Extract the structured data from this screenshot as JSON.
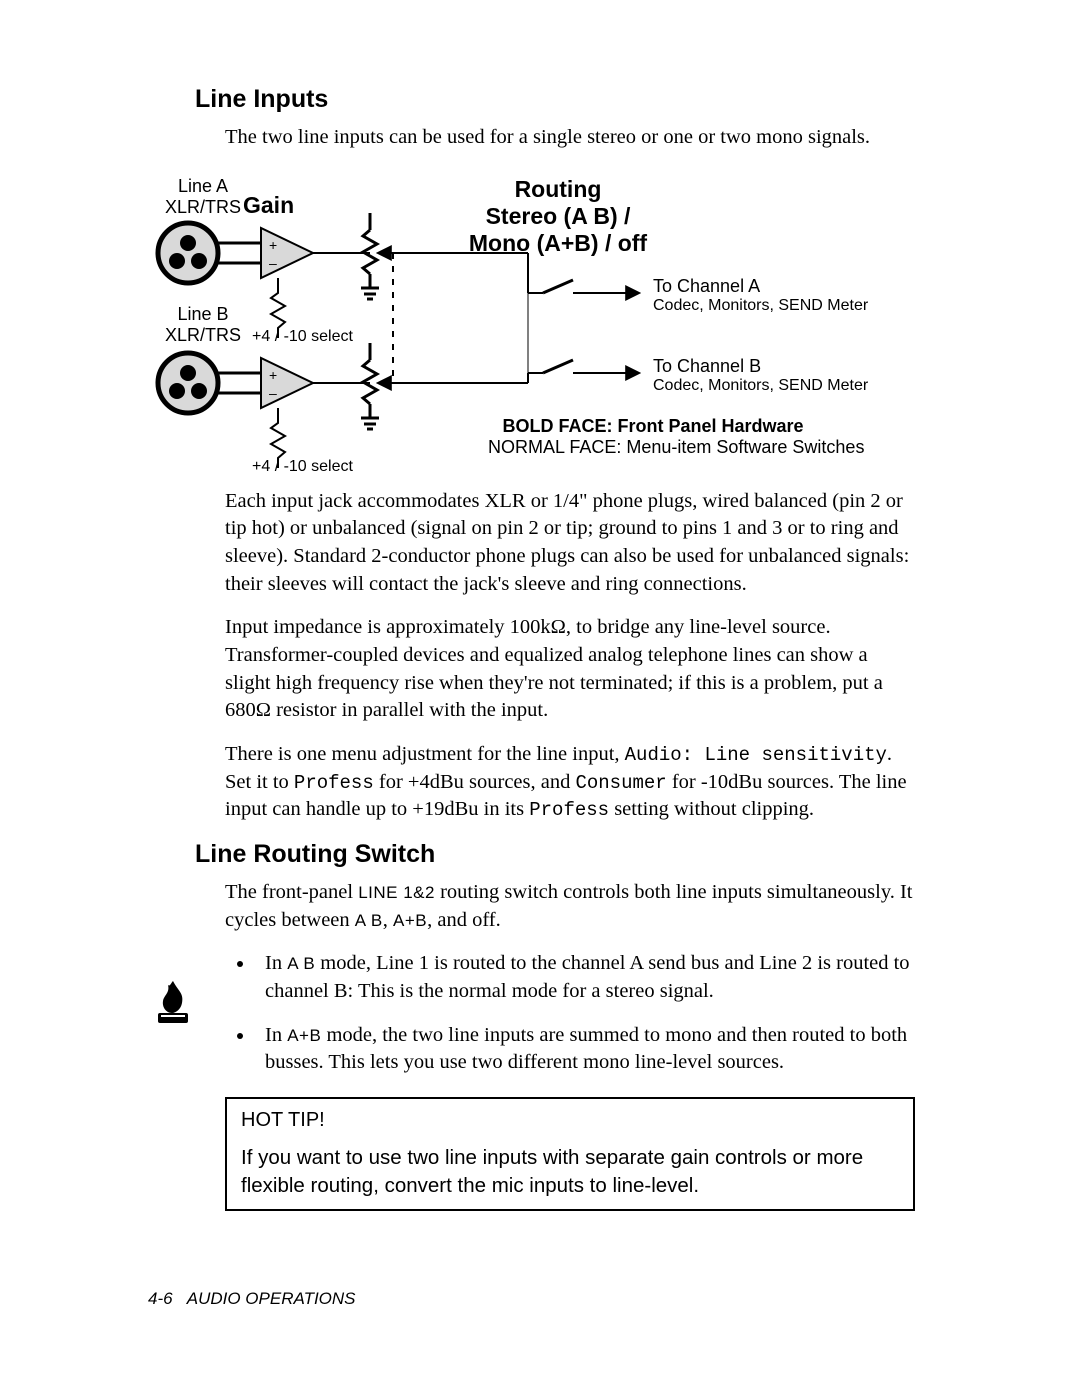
{
  "headings": {
    "line_inputs": "Line Inputs",
    "line_routing_switch": "Line Routing Switch"
  },
  "paragraphs": {
    "li_intro": "The two line inputs can be used for a single stereo or one or two mono signals.",
    "jacks": "Each input jack accommodates XLR or 1/4\" phone plugs, wired balanced (pin 2 or tip hot) or unbalanced (signal on pin 2 or tip; ground to pins 1 and 3 or to ring and sleeve). Standard 2-conductor phone plugs can also be used for unbalanced signals: their sleeves will contact the jack's sleeve and ring connections.",
    "impedance": "Input impedance is  approximately 100kΩ, to bridge any line-level source. Transformer-coupled devices and equalized analog telephone lines can show a slight high frequency rise when they're not terminated; if this is a problem, put a 680Ω resistor in parallel with the input.",
    "menu1_a": "There is one menu adjustment for the line input, ",
    "menu1_code1": "Audio: Line sensitivity",
    "menu1_b": ". Set it to ",
    "menu1_code2": "Profess",
    "menu1_c": " for +4dBu sources, and ",
    "menu1_code3": "Consumer",
    "menu1_d": " for -10dBu sources. The line input can handle up to +19dBu in its ",
    "menu1_code4": "Profess",
    "menu1_e": " setting without clipping.",
    "routing_intro_a": "The front-panel ",
    "routing_sc1": "LINE 1&2",
    "routing_intro_b": " routing switch controls both line inputs simultaneously. It cycles between ",
    "routing_sc2": "A B",
    "routing_intro_c": ", ",
    "routing_sc3": "A+B",
    "routing_intro_d": ", and off."
  },
  "bullets": {
    "b1_a": "In ",
    "b1_sc": "A B",
    "b1_b": " mode, Line 1 is routed to the channel A send bus and Line 2 is routed to channel B: This is the normal mode for a stereo signal.",
    "b2_a": "In ",
    "b2_sc": "A+B",
    "b2_b": " mode, the two line inputs are summed to mono and then routed to both busses. This lets you use two different mono line-level sources."
  },
  "tip": {
    "head": "HOT TIP!",
    "body": "If you want to use two line inputs with separate gain controls or more flexible routing, convert the mic inputs to line-level."
  },
  "diagram": {
    "lineA": "Line A",
    "lineB": "Line B",
    "xlrtrs": "XLR/TRS",
    "gain": "Gain",
    "routing1": "Routing",
    "routing2": "Stereo (A B) /",
    "routing3": "Mono (A+B) / off",
    "sel": "+4 / -10  select",
    "toA1": "To Channel A",
    "toA2": "Codec, Monitors, SEND Meter",
    "toB1": "To Channel B",
    "toB2": "Codec, Monitors, SEND Meter",
    "legend1": "BOLD FACE:  Front Panel Hardware",
    "legend2": "NORMAL FACE: Menu-item Software Switches"
  },
  "footer": {
    "pagenum": "4-6",
    "section": "AUDIO OPERATIONS"
  }
}
